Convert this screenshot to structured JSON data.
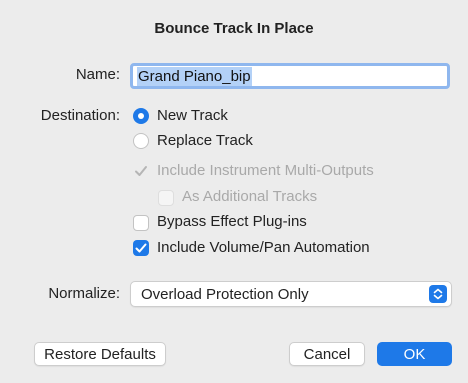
{
  "dialog": {
    "title": "Bounce Track In Place",
    "name_label": "Name:",
    "name_value": "Grand Piano_bip",
    "destination_label": "Destination:",
    "destination_options": [
      {
        "label": "New Track",
        "selected": true
      },
      {
        "label": "Replace Track",
        "selected": false
      }
    ],
    "checkboxes": [
      {
        "label": "Include Instrument Multi-Outputs",
        "checked": true,
        "enabled": false
      },
      {
        "label": "As Additional Tracks",
        "checked": false,
        "enabled": false
      },
      {
        "label": "Bypass Effect Plug-ins",
        "checked": false,
        "enabled": true
      },
      {
        "label": "Include Volume/Pan Automation",
        "checked": true,
        "enabled": true
      }
    ],
    "normalize_label": "Normalize:",
    "normalize_value": "Overload Protection Only",
    "buttons": {
      "restore": "Restore Defaults",
      "cancel": "Cancel",
      "ok": "OK"
    }
  },
  "colors": {
    "accent": "#1e79e8",
    "background": "#ececec",
    "selection": "#b3d1f7"
  }
}
